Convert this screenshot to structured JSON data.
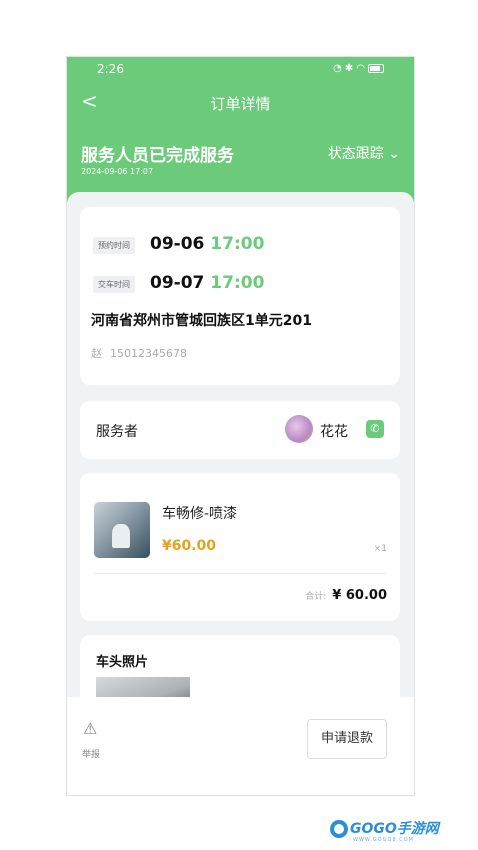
{
  "statusbar": {
    "time": "2:26"
  },
  "header": {
    "title": "订单详情",
    "status": "服务人员已完成服务",
    "status_time": "2024-09-06 17:07",
    "track": "状态跟踪"
  },
  "booking": {
    "appointment_tag": "预约时间",
    "appointment_date": "09-06",
    "appointment_time": "17:00",
    "delivery_tag": "交车时间",
    "delivery_date": "09-07",
    "delivery_time": "17:00",
    "address": "河南省郑州市管城回族区1单元201",
    "contact_name": "赵",
    "contact_phone": "15012345678"
  },
  "server": {
    "label": "服务者",
    "name": "花花"
  },
  "product": {
    "name": "车畅修-喷漆",
    "price": "¥60.00",
    "qty": "×1",
    "total_label": "合计:",
    "total": "¥ 60.00"
  },
  "photos": {
    "title": "车头照片"
  },
  "bottom": {
    "report_label": "举报",
    "refund_label": "申请退款"
  },
  "watermark": {
    "text": "GOGO手游网",
    "sub": "WWW.GOGO8.COM"
  },
  "colors": {
    "primary_green": "#6ccb7b",
    "price_orange": "#e6a21c"
  }
}
